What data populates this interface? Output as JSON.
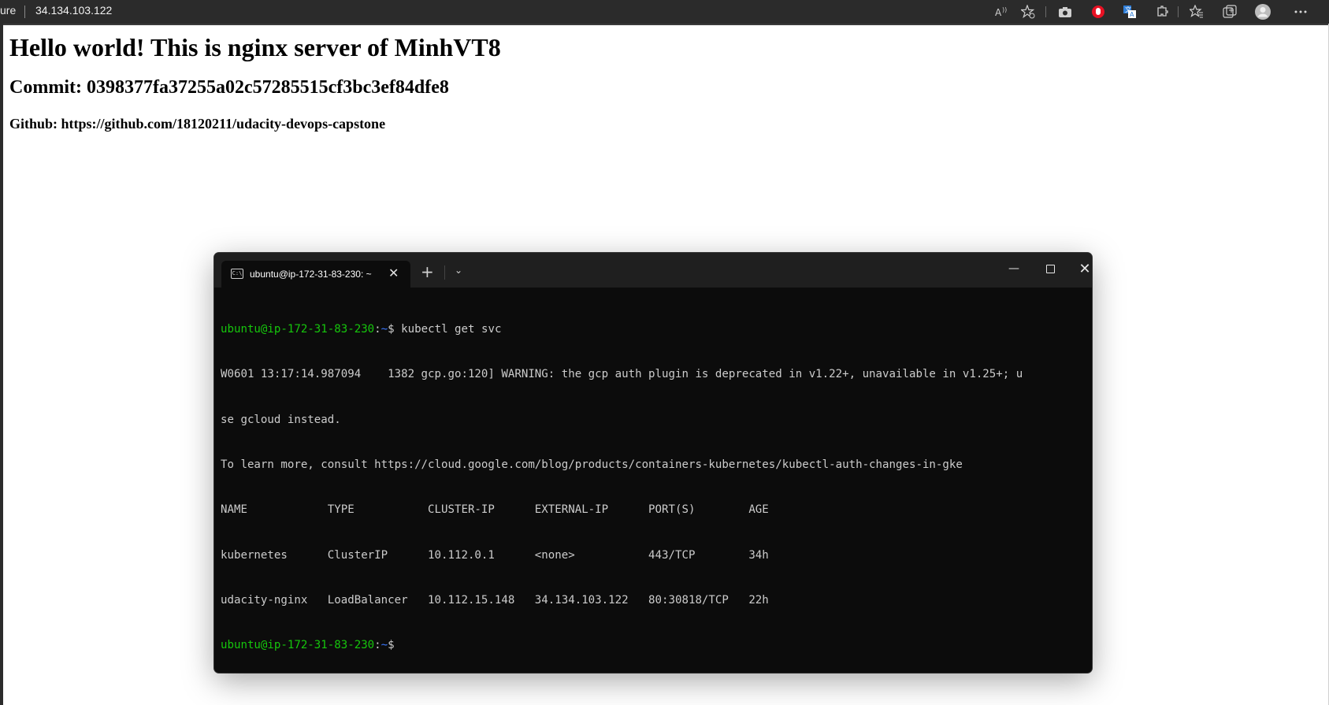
{
  "browser": {
    "secure_label": "ure",
    "url": "34.134.103.122",
    "toolbar_icons": [
      "read-aloud-icon",
      "favorite-add-icon",
      "screenshot-icon",
      "extension-red-icon",
      "translate-icon",
      "extensions-icon",
      "favorites-icon",
      "collections-icon",
      "profile-icon",
      "more-icon"
    ]
  },
  "page": {
    "heading": "Hello world! This is nginx server of MinhVT8",
    "commit": "Commit: 0398377fa37255a02c57285515cf3bc3ef84dfe8",
    "github": "Github: https://github.com/18120211/udacity-devops-capstone"
  },
  "terminal": {
    "tab_title": "ubuntu@ip-172-31-83-230: ~",
    "prompt_user": "ubuntu@ip-172-31-83-230",
    "prompt_sep": ":",
    "prompt_path": "~",
    "prompt_end": "$",
    "command": " kubectl get svc",
    "output_lines": [
      "W0601 13:17:14.987094    1382 gcp.go:120] WARNING: the gcp auth plugin is deprecated in v1.22+, unavailable in v1.25+; u",
      "se gcloud instead.",
      "To learn more, consult https://cloud.google.com/blog/products/containers-kubernetes/kubectl-auth-changes-in-gke",
      "NAME            TYPE           CLUSTER-IP      EXTERNAL-IP      PORT(S)        AGE",
      "kubernetes      ClusterIP      10.112.0.1      <none>           443/TCP        34h",
      "udacity-nginx   LoadBalancer   10.112.15.148   34.134.103.122   80:30818/TCP   22h"
    ]
  }
}
